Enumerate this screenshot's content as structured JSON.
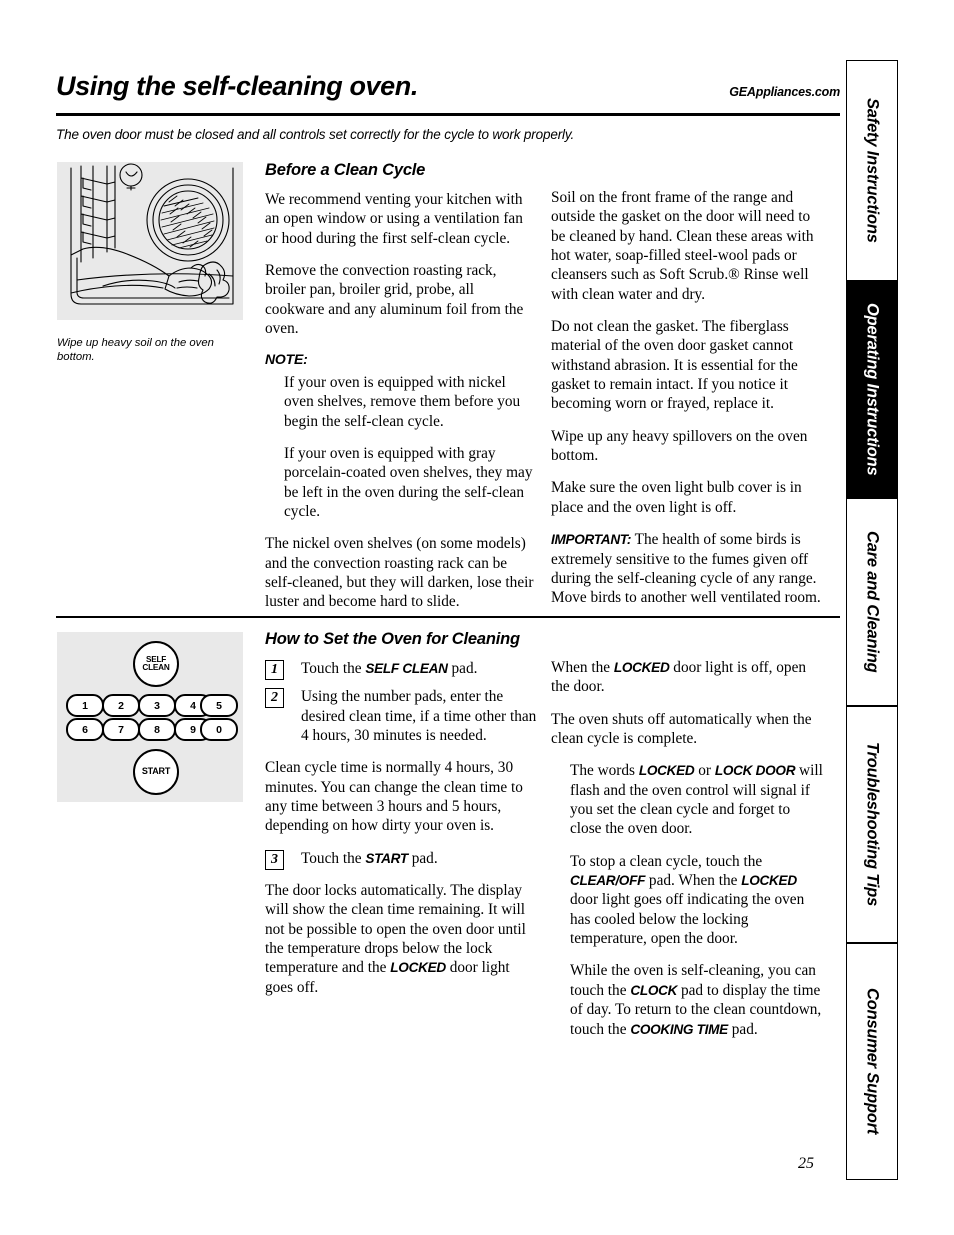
{
  "header": {
    "title": "Using the self-cleaning oven.",
    "url": "GEAppliances.com",
    "subtitle": "The oven door must be closed and all controls set correctly for the cycle to work properly."
  },
  "figures": {
    "oven": {
      "caption": "Wipe up heavy soil on the oven bottom.",
      "alt": "Hand wiping soil from the oven bottom"
    },
    "keypad": {
      "self_clean_line1": "SELF",
      "self_clean_line2": "CLEAN",
      "start": "START",
      "row1": [
        "1",
        "2",
        "3",
        "4",
        "5"
      ],
      "row2": [
        "6",
        "7",
        "8",
        "9",
        "0"
      ]
    }
  },
  "section_before": {
    "heading": "Before a Clean Cycle",
    "left": [
      "We recommend venting your kitchen with an open window or using a ventilation fan or hood during the first self-clean cycle.",
      "Remove the convection roasting rack, broiler pan, broiler grid, probe, all cookware and any aluminum foil from the oven."
    ],
    "note_label": "NOTE:",
    "note_items": [
      "If your oven is equipped with nickel oven shelves, remove them before you begin the self-clean cycle.",
      "If your oven is equipped with gray porcelain-coated oven shelves, they may be left in the oven during the self-clean cycle."
    ],
    "left_tail": [
      "The nickel oven shelves (on some models) and the convection roasting rack can be self-cleaned, but they will darken, lose their luster and become hard to slide."
    ],
    "right": [
      "Soil on the front frame of the range and outside the gasket on the door will need to be cleaned by hand. Clean these areas with hot water, soap-filled steel-wool pads or cleansers such as Soft Scrub.®  Rinse well with clean water and dry.",
      "Do not clean the gasket. The fiberglass material of the oven door gasket cannot withstand abrasion. It is essential for the gasket to remain intact. If you notice it becoming worn or frayed, replace it.",
      "Wipe up any heavy spillovers on the oven bottom.",
      "Make sure the oven light bulb cover is in place and the oven light is off."
    ],
    "important_label": "IMPORTANT:",
    "important_text": "  The health of some birds is extremely sensitive to the fumes given off during the self-cleaning cycle of any range. Move birds to another well ventilated room."
  },
  "section_howto": {
    "heading": "How to Set the Oven for Cleaning",
    "steps": [
      {
        "num": "1",
        "pre": "Touch the ",
        "pad": "SELF CLEAN",
        "post": " pad."
      },
      {
        "num": "2",
        "pre": "Using the number pads, enter the desired clean time, if a time other than 4 hours, 30 minutes is needed.",
        "pad": "",
        "post": ""
      },
      {
        "num": "3",
        "pre": "Touch the ",
        "pad": "START",
        "post": " pad."
      }
    ],
    "after_step2": "Clean cycle time is normally 4 hours, 30 minutes. You can change the clean time to any time between 3 hours and 5 hours, depending on how dirty your oven is.",
    "after_step3_pre": "The door locks automatically. The display will show the clean time remaining. It will not be possible to open the oven door until the temperature drops below the lock temperature and the ",
    "after_step3_pad": "LOCKED",
    "after_step3_post": " door light goes off.",
    "right": {
      "p1_pre": "When the ",
      "p1_pad": "LOCKED",
      "p1_post": " door  light is off, open the door.",
      "p2": "The oven shuts off automatically when the clean cycle is complete.",
      "p3_pre": "The words ",
      "p3_pad1": "LOCKED",
      "p3_mid": " or ",
      "p3_pad2": "LOCK DOOR",
      "p3_post": " will flash and the oven control will signal if you set the clean cycle and forget to close the oven door.",
      "p4_pre": "To stop a clean cycle, touch the ",
      "p4_pad1": "CLEAR/OFF",
      "p4_mid": " pad. When the ",
      "p4_pad2": "LOCKED",
      "p4_post": " door light goes off indicating the oven has cooled below the locking temperature, open the door.",
      "p5_pre": "While the oven is self-cleaning, you can touch the ",
      "p5_pad1": "CLOCK",
      "p5_mid": " pad to display the time of day. To return to the clean countdown, touch the ",
      "p5_pad2": "COOKING TIME",
      "p5_post": " pad."
    }
  },
  "tabs": [
    {
      "label": "Safety Instructions",
      "active": false
    },
    {
      "label": "Operating Instructions",
      "active": true
    },
    {
      "label": "Care and Cleaning",
      "active": false
    },
    {
      "label": "Troubleshooting Tips",
      "active": false
    },
    {
      "label": "Consumer Support",
      "active": false
    }
  ],
  "page_number": "25",
  "colors": {
    "ink": "#000000",
    "figure_bg": "#e9e9e9",
    "paper": "#ffffff"
  }
}
